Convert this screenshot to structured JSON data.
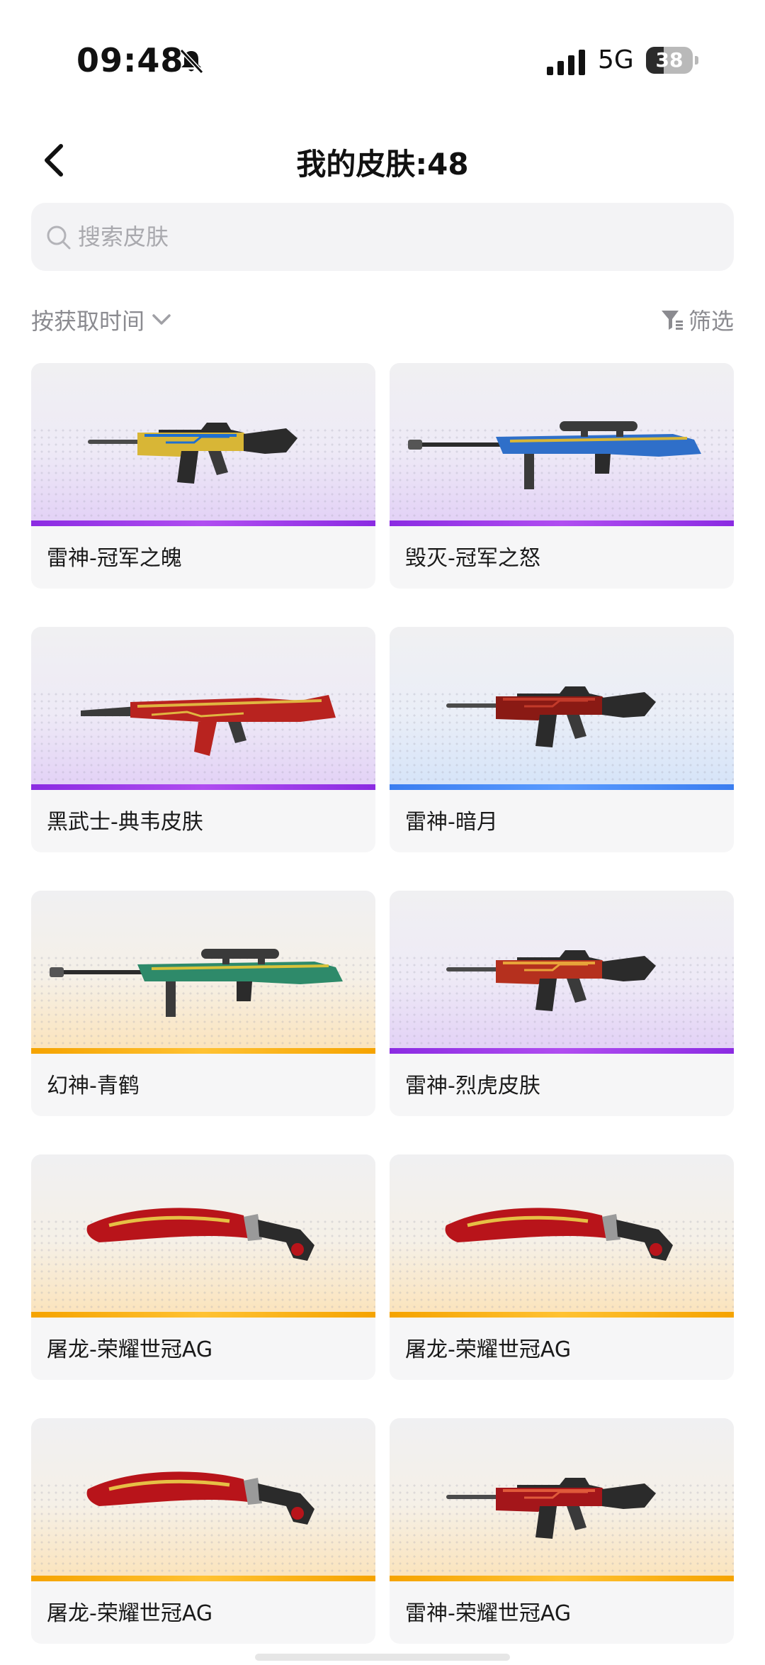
{
  "status_bar": {
    "time": "09:48",
    "network": "5G",
    "battery": "38",
    "battery_level": 0.38
  },
  "header": {
    "title": "我的皮肤:48",
    "back_icon": "chevron-left-icon"
  },
  "search": {
    "placeholder": "搜索皮肤",
    "value": "",
    "icon": "search-icon"
  },
  "toolbar": {
    "sort_label": "按获取时间",
    "filter_label": "筛选",
    "filter_icon": "funnel-icon"
  },
  "rarity_colors": {
    "purple": "#9b3bea",
    "blue": "#4a8cf5",
    "gold": "#ffb21a"
  },
  "skins": [
    {
      "name": "雷神-冠军之魄",
      "rarity": "purple",
      "weapon": "rifle"
    },
    {
      "name": "毁灭-冠军之怒",
      "rarity": "purple",
      "weapon": "sniper"
    },
    {
      "name": "黑武士-典韦皮肤",
      "rarity": "purple",
      "weapon": "ak"
    },
    {
      "name": "雷神-暗月",
      "rarity": "blue",
      "weapon": "rifle"
    },
    {
      "name": "幻神-青鹤",
      "rarity": "gold",
      "weapon": "sniper"
    },
    {
      "name": "雷神-烈虎皮肤",
      "rarity": "purple",
      "weapon": "rifle"
    },
    {
      "name": "屠龙-荣耀世冠AG",
      "rarity": "gold",
      "weapon": "knife"
    },
    {
      "name": "屠龙-荣耀世冠AG",
      "rarity": "gold",
      "weapon": "knife"
    },
    {
      "name": "屠龙-荣耀世冠AG",
      "rarity": "gold",
      "weapon": "knife"
    },
    {
      "name": "雷神-荣耀世冠AG",
      "rarity": "gold",
      "weapon": "rifle"
    }
  ]
}
